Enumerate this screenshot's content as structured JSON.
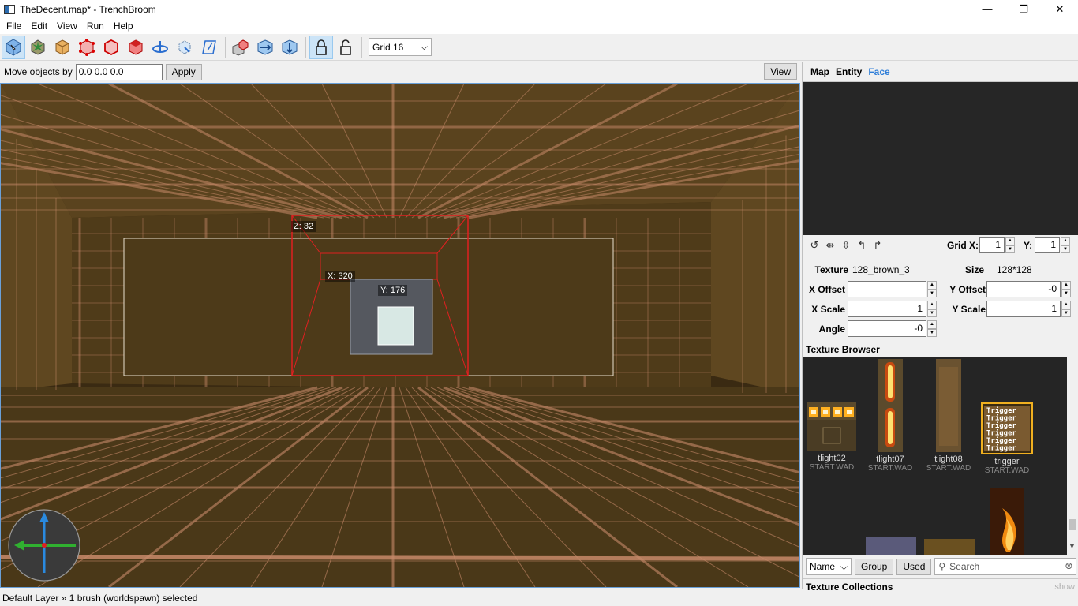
{
  "window": {
    "title": "TheDecent.map* - TrenchBroom",
    "minimize": "—",
    "maximize": "❐",
    "close": "✕"
  },
  "menu": [
    "File",
    "Edit",
    "View",
    "Run",
    "Help"
  ],
  "toolbar": {
    "grid_value": "Grid 16"
  },
  "move": {
    "label": "Move objects by",
    "value": "0.0 0.0 0.0",
    "apply": "Apply",
    "view": "View"
  },
  "viewport": {
    "dim_z": "Z: 32",
    "dim_x": "X: 320",
    "dim_y": "Y: 176"
  },
  "status": {
    "text": "Default Layer » 1 brush (worldspawn) selected"
  },
  "inspector": {
    "tabs": [
      "Map",
      "Entity",
      "Face"
    ],
    "active_tab": "Face",
    "grid_x_label": "Grid X:",
    "grid_x": "1",
    "grid_y_label": "Y:",
    "grid_y": "1",
    "texture_label": "Texture",
    "texture": "128_brown_3",
    "size_label": "Size",
    "size": "128*128",
    "x_offset_label": "X Offset",
    "x_offset": "",
    "y_offset_label": "Y Offset",
    "y_offset": "-0",
    "x_scale_label": "X Scale",
    "x_scale": "1",
    "y_scale_label": "Y Scale",
    "y_scale": "1",
    "angle_label": "Angle",
    "angle": "-0"
  },
  "texture_browser": {
    "title": "Texture Browser",
    "textures": [
      {
        "name": "tlight02",
        "wad": "START.WAD"
      },
      {
        "name": "tlight07",
        "wad": "START.WAD"
      },
      {
        "name": "tlight08",
        "wad": "START.WAD"
      },
      {
        "name": "trigger",
        "wad": "START.WAD"
      }
    ],
    "trigger_word": "Trigger",
    "sort": "Name",
    "group": "Group",
    "used": "Used",
    "search_placeholder": "Search",
    "collections": "Texture Collections",
    "show": "show"
  },
  "colors": {
    "accent": "#2f7ed8",
    "viewport_bg": "#3a2a12",
    "grid_line": "#c88a6a",
    "selection": "#e02020"
  }
}
